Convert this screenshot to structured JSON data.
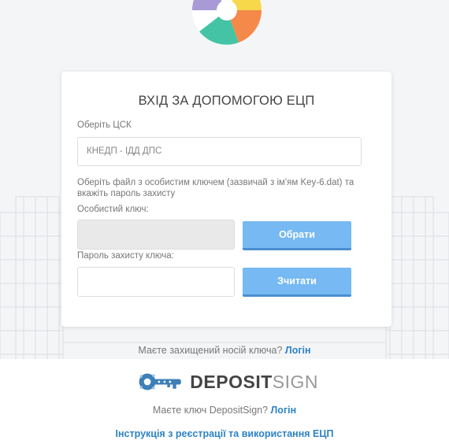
{
  "card": {
    "title": "ВХІД ЗА ДОПОМОГОЮ ЕЦП",
    "provider_label": "Оберіть ЦСК",
    "provider_value": "КНЕДП - ІДД ДПС",
    "key_hint": "Оберіть файл з особистим ключем (зазвичай з ім'ям Key-6.dat) та вкажіть пароль захисту",
    "key_label": "Особистий ключ:",
    "pick_button": "Обрати",
    "password_label": "Пароль захисту ключа:",
    "password_value": "",
    "read_button": "Зчитати"
  },
  "secure_media": {
    "text": "Маєте захищений носій ключа?",
    "link": "Логін"
  },
  "depositsign": {
    "brand_bold": "DEPOSIT",
    "brand_light": "SIGN",
    "text": "Маєте ключ DepositSign?",
    "link": "Логін"
  },
  "instructions_link": "Інструкція з реєстрації та використання ЕЦП",
  "colors": {
    "button": "#77b9f2",
    "link": "#2d82c6",
    "logo_purple": "#a89ad6",
    "logo_yellow": "#f7d84a",
    "logo_teal": "#45c4a5",
    "logo_orange": "#f5894a"
  }
}
